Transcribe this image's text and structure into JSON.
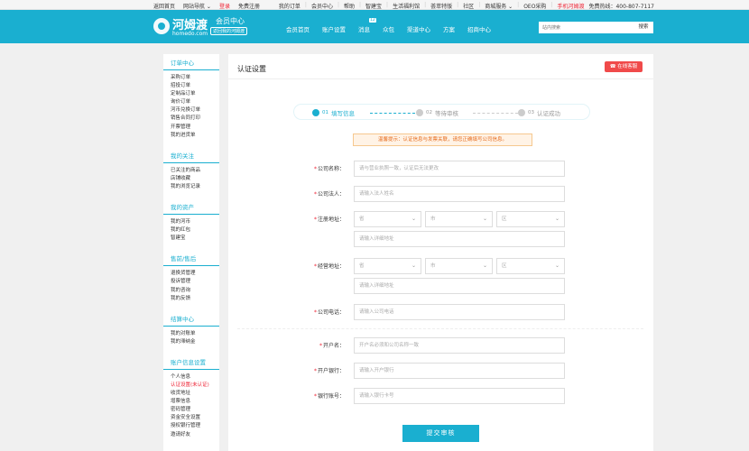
{
  "topbar": {
    "left": [
      "返回首页",
      "网站导航 ⌄",
      "登录",
      "免费注册"
    ],
    "right": [
      "我的订单",
      "|",
      "会员中心",
      "|",
      "帮助",
      "|",
      "智建宝",
      "|",
      "生活福利馆",
      "|",
      "荟萃特版",
      "|",
      "社区",
      "|",
      "商城服务 ⌄",
      "|",
      "OEO采购",
      "|",
      "手机河姆渡",
      "免费热线：400-807-7117"
    ]
  },
  "header": {
    "logo_cn": "河姆渡",
    "logo_en": "homedo.com",
    "member_center": "会员中心",
    "back_home": "返回我的河姆渡",
    "nav": [
      "会员首页",
      "账户设置",
      "消息",
      "众包",
      "渠道中心",
      "方案",
      "招商中心"
    ],
    "msg_badge": "12",
    "search_placeholder": "站内搜索",
    "search_button": "搜索"
  },
  "sidebar": [
    {
      "title": "订单中心",
      "items": [
        "采购订单",
        "招投订单",
        "定制品订单",
        "询价订单",
        "河币兑换订单",
        "销售合同打印",
        "开票管理",
        "我的进货单"
      ]
    },
    {
      "title": "我的关注",
      "items": [
        "已关注的商品",
        "店铺收藏",
        "我的浏览记录"
      ]
    },
    {
      "title": "我的资产",
      "items": [
        "我的河币",
        "我的红包",
        "智建宝"
      ]
    },
    {
      "title": "售前/售后",
      "items": [
        "退换货管理",
        "投诉管理",
        "我的咨询",
        "我的反馈"
      ]
    },
    {
      "title": "结算中心",
      "items": [
        "我的对账单",
        "我的滞纳金"
      ]
    },
    {
      "title": "账户信息设置",
      "items": [
        "个人信息",
        "认证设置(未认证)",
        "收货地址",
        "增票信息",
        "密码管理",
        "资金安全设置",
        "授权银行管理",
        "邀请好友"
      ]
    }
  ],
  "sidebar_active": "认证设置(未认证)",
  "main": {
    "title": "认证设置",
    "service_button": "在线客服",
    "steps": [
      {
        "num": "01",
        "label": "填写信息"
      },
      {
        "num": "02",
        "label": "等待审核"
      },
      {
        "num": "03",
        "label": "认证成功"
      }
    ],
    "tip": "温馨提示：认证信息与发票关联，请您正确填写公司信息。",
    "form": {
      "company_name_label": "公司名称",
      "company_name_placeholder": "请与营业执照一致，认证后无法更改",
      "legal_person_label": "公司法人",
      "legal_person_placeholder": "请输入法人姓名",
      "reg_address_label": "注册地址",
      "province": "省",
      "city": "市",
      "district": "区",
      "address_placeholder": "请输入详细地址",
      "biz_address_label": "经营地址",
      "phone_label": "公司电话",
      "phone_placeholder": "请输入公司电话",
      "account_name_label": "开户名",
      "account_name_placeholder": "开户名必须和公司名称一致",
      "bank_label": "开户银行",
      "bank_placeholder": "请输入开户银行",
      "bank_no_label": "银行账号",
      "bank_no_placeholder": "请输入银行卡号",
      "required_mark": "*",
      "colon": "：",
      "chevron": "⌄"
    },
    "submit": "提交审核"
  },
  "colors": {
    "accent": "#1aafd0",
    "danger": "#e22233",
    "service": "#f04a4a"
  }
}
